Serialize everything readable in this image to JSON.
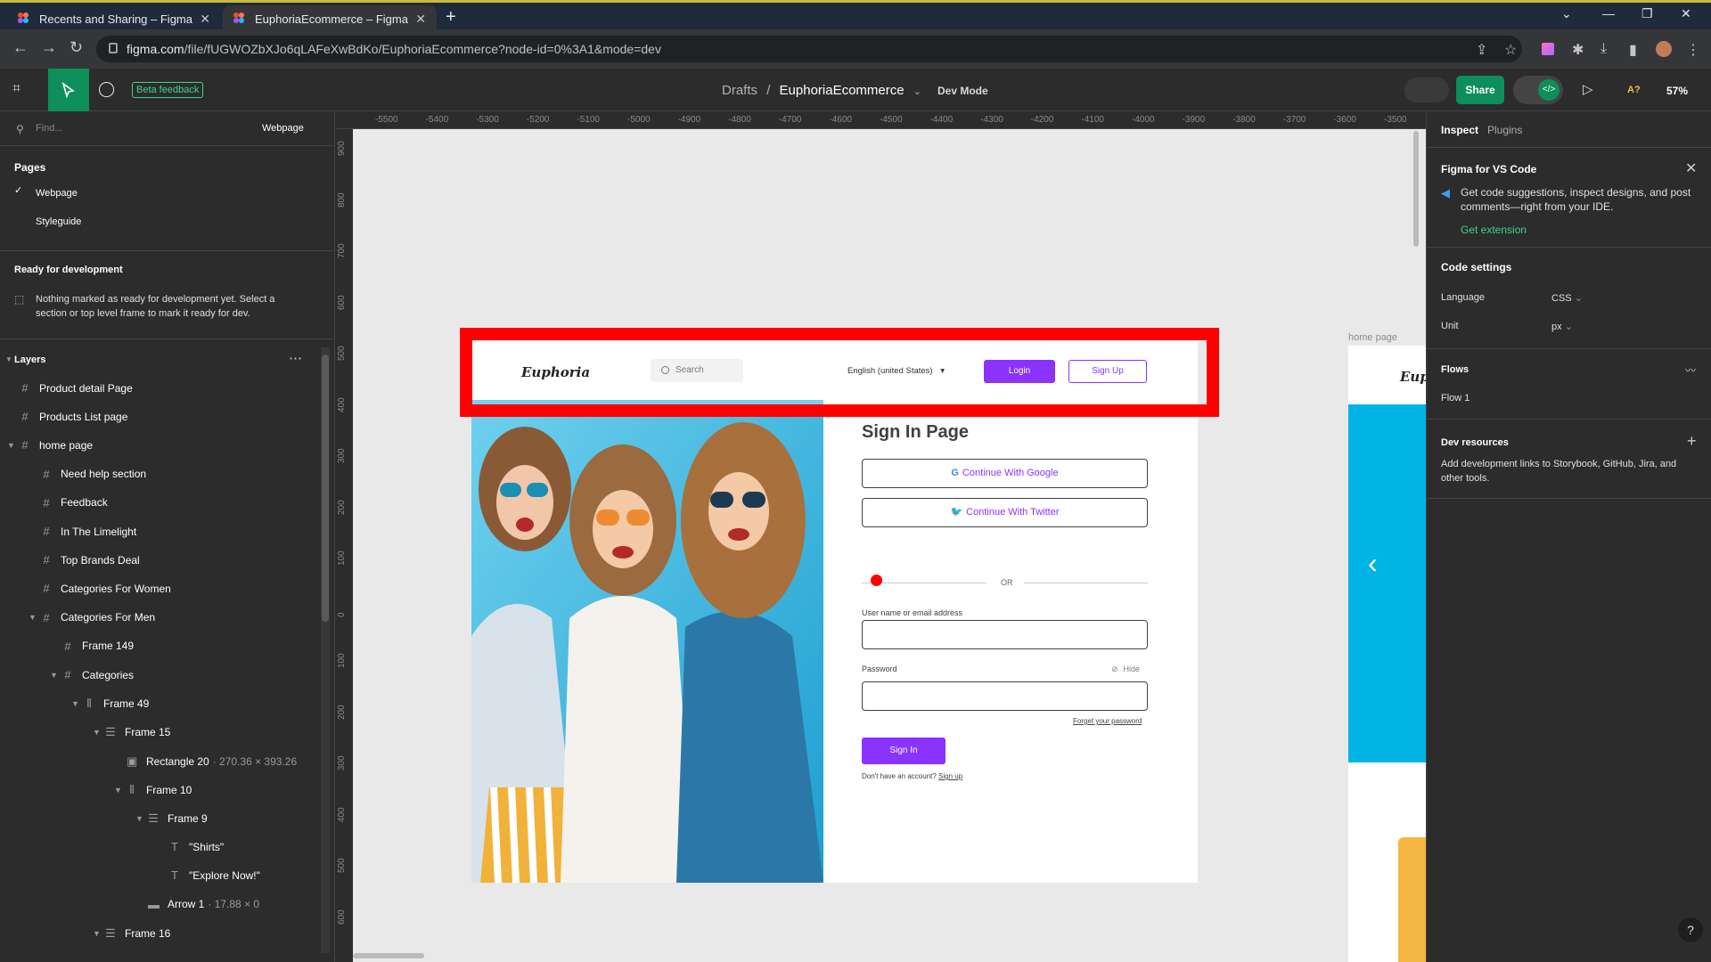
{
  "browser": {
    "tabs": [
      {
        "title": "Recents and Sharing – Figma"
      },
      {
        "title": "EuphoriaEcommerce – Figma"
      }
    ],
    "url_host": "figma.com",
    "url_path": "/file/fUGWOZbXJo6qLAFeXwBdKo/EuphoriaEcommerce?node-id=0%3A1&mode=dev"
  },
  "toolbar": {
    "beta_label": "Beta feedback",
    "breadcrumb_parent": "Drafts",
    "breadcrumb_sep": "/",
    "file_name": "EuphoriaEcommerce",
    "mode_label": "Dev Mode",
    "share_label": "Share",
    "font_warning": "A?",
    "zoom": "57%"
  },
  "left": {
    "find_placeholder": "Find...",
    "current_page": "Webpage",
    "pages_title": "Pages",
    "pages": [
      "Webpage",
      "Styleguide"
    ],
    "ready_title": "Ready for development",
    "ready_text_1": "Nothing marked as ready for development yet. Select a",
    "ready_text_2": "section or top level frame to mark it ready for dev.",
    "layers_title": "Layers",
    "layers": [
      {
        "label": "Product detail Page",
        "dim": ""
      },
      {
        "label": "Products List page",
        "dim": ""
      },
      {
        "label": "home page",
        "dim": ""
      },
      {
        "label": "Need help section",
        "dim": ""
      },
      {
        "label": "Feedback",
        "dim": ""
      },
      {
        "label": "In The Limelight",
        "dim": ""
      },
      {
        "label": "Top Brands Deal",
        "dim": ""
      },
      {
        "label": "Categories For Women",
        "dim": ""
      },
      {
        "label": "Categories For Men",
        "dim": ""
      },
      {
        "label": "Frame 149",
        "dim": ""
      },
      {
        "label": "Categories",
        "dim": ""
      },
      {
        "label": "Frame 49",
        "dim": ""
      },
      {
        "label": "Frame 15",
        "dim": ""
      },
      {
        "label": "Rectangle 20",
        "dim": "· 270.36 × 393.26"
      },
      {
        "label": "Frame 10",
        "dim": ""
      },
      {
        "label": "Frame 9",
        "dim": ""
      },
      {
        "label": "\"Shirts\"",
        "dim": ""
      },
      {
        "label": "\"Explore Now!\"",
        "dim": ""
      },
      {
        "label": "Arrow 1",
        "dim": "· 17.88 × 0"
      },
      {
        "label": "Frame 16",
        "dim": ""
      }
    ]
  },
  "rulers": {
    "h": [
      "-5500",
      "-5400",
      "-5300",
      "-5200",
      "-5100",
      "-5000",
      "-4900",
      "-4800",
      "-4700",
      "-4600",
      "-4500",
      "-4400",
      "-4300",
      "-4200",
      "-4100",
      "-4000",
      "-3900",
      "-3800",
      "-3700",
      "-3600",
      "-3500"
    ],
    "v": [
      "900",
      "800",
      "700",
      "600",
      "500",
      "400",
      "300",
      "200",
      "100",
      "0",
      "100",
      "200",
      "300",
      "400",
      "500",
      "600"
    ]
  },
  "canvas": {
    "frame_logo": "Euphoria",
    "search_placeholder": "Search",
    "language": "English (united States)",
    "login": "Login",
    "signup": "Sign Up",
    "signin_title": "Sign In Page",
    "google_btn": "Continue With Google",
    "twitter_btn": "Continue With Twitter",
    "or": "OR",
    "username_label": "User name or email address",
    "password_label": "Password",
    "hide": "Hide",
    "forgot": "Forget your password",
    "signin_btn": "Sign In",
    "no_account": "Don't have an account?",
    "signup_link": "Sign up",
    "frame2_label": "home page",
    "frame2_logo": "Euph"
  },
  "right": {
    "tab_inspect": "Inspect",
    "tab_plugins": "Plugins",
    "vscode_title": "Figma for VS Code",
    "vscode_text_1": "Get code suggestions, inspect designs, and post",
    "vscode_text_2": "comments—right from your IDE.",
    "get_extension": "Get extension",
    "code_settings": "Code settings",
    "language_label": "Language",
    "language_value": "CSS",
    "unit_label": "Unit",
    "unit_value": "px",
    "flows_title": "Flows",
    "flow_1": "Flow 1",
    "dev_resources": "Dev resources",
    "dev_text_1": "Add development links to Storybook, GitHub, Jira, and",
    "dev_text_2": "other tools.",
    "help": "?"
  },
  "colors": {
    "accent": "#8a33fd",
    "figma_green": "#0e8f5a",
    "highlight": "#ff0000"
  }
}
